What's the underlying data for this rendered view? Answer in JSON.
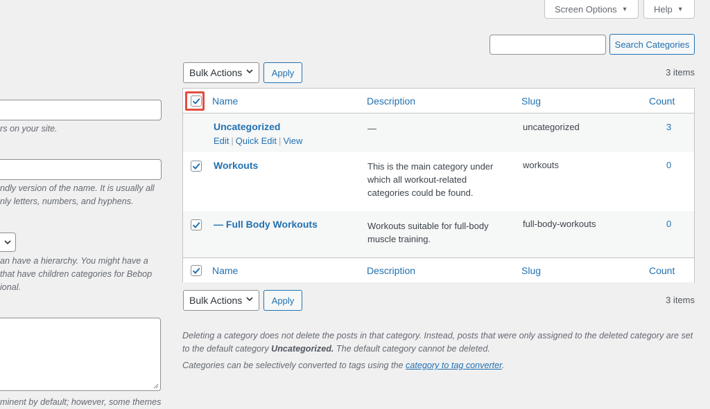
{
  "screen_options": {
    "label": "Screen Options"
  },
  "help": {
    "label": "Help"
  },
  "search": {
    "button_label": "Search Categories",
    "placeholder": ""
  },
  "bulk_actions": {
    "top_label": "Bulk Actions",
    "bottom_label": "Bulk Actions",
    "apply_label": "Apply"
  },
  "items_count": {
    "top": "3 items",
    "bottom": "3 items"
  },
  "left_form": {
    "name_hint": "rs on your site.",
    "slug_hint_line1": "ndly version of the name. It is usually all",
    "slug_hint_line2": "nly letters, numbers, and hyphens.",
    "parent_hint_line1": "an have a hierarchy. You might have a",
    "parent_hint_line2": "that have children categories for Bebop",
    "parent_hint_line3": "ional.",
    "description_hint": "minent by default; however, some themes"
  },
  "table": {
    "columns": {
      "name": "Name",
      "description": "Description",
      "slug": "Slug",
      "count": "Count"
    },
    "rows": [
      {
        "name": "Uncategorized",
        "description": "—",
        "slug": "uncategorized",
        "count": "3",
        "actions": {
          "edit": "Edit",
          "quick_edit": "Quick Edit",
          "view": "View"
        }
      },
      {
        "name": "Workouts",
        "description": "This is the main category under which all workout-related categories could be found.",
        "slug": "workouts",
        "count": "0",
        "checked": true
      },
      {
        "name": "— Full Body Workouts",
        "description": "Workouts suitable for full-body muscle training.",
        "slug": "full-body-workouts",
        "count": "0",
        "checked": true
      }
    ]
  },
  "footnotes": {
    "line1_a": "Deleting a category does not delete the posts in that category. Instead, posts that were only assigned to the deleted category are set",
    "line1_b": "to the default category ",
    "default_category": "Uncategorized.",
    "line1_c": " The default category cannot be deleted.",
    "line2_a": "Categories can be selectively converted to tags using the ",
    "converter_link": "category to tag converter",
    "line2_b": "."
  },
  "colors": {
    "accent": "#2271b1",
    "highlight": "#e14d43",
    "background": "#f0f0f1"
  }
}
